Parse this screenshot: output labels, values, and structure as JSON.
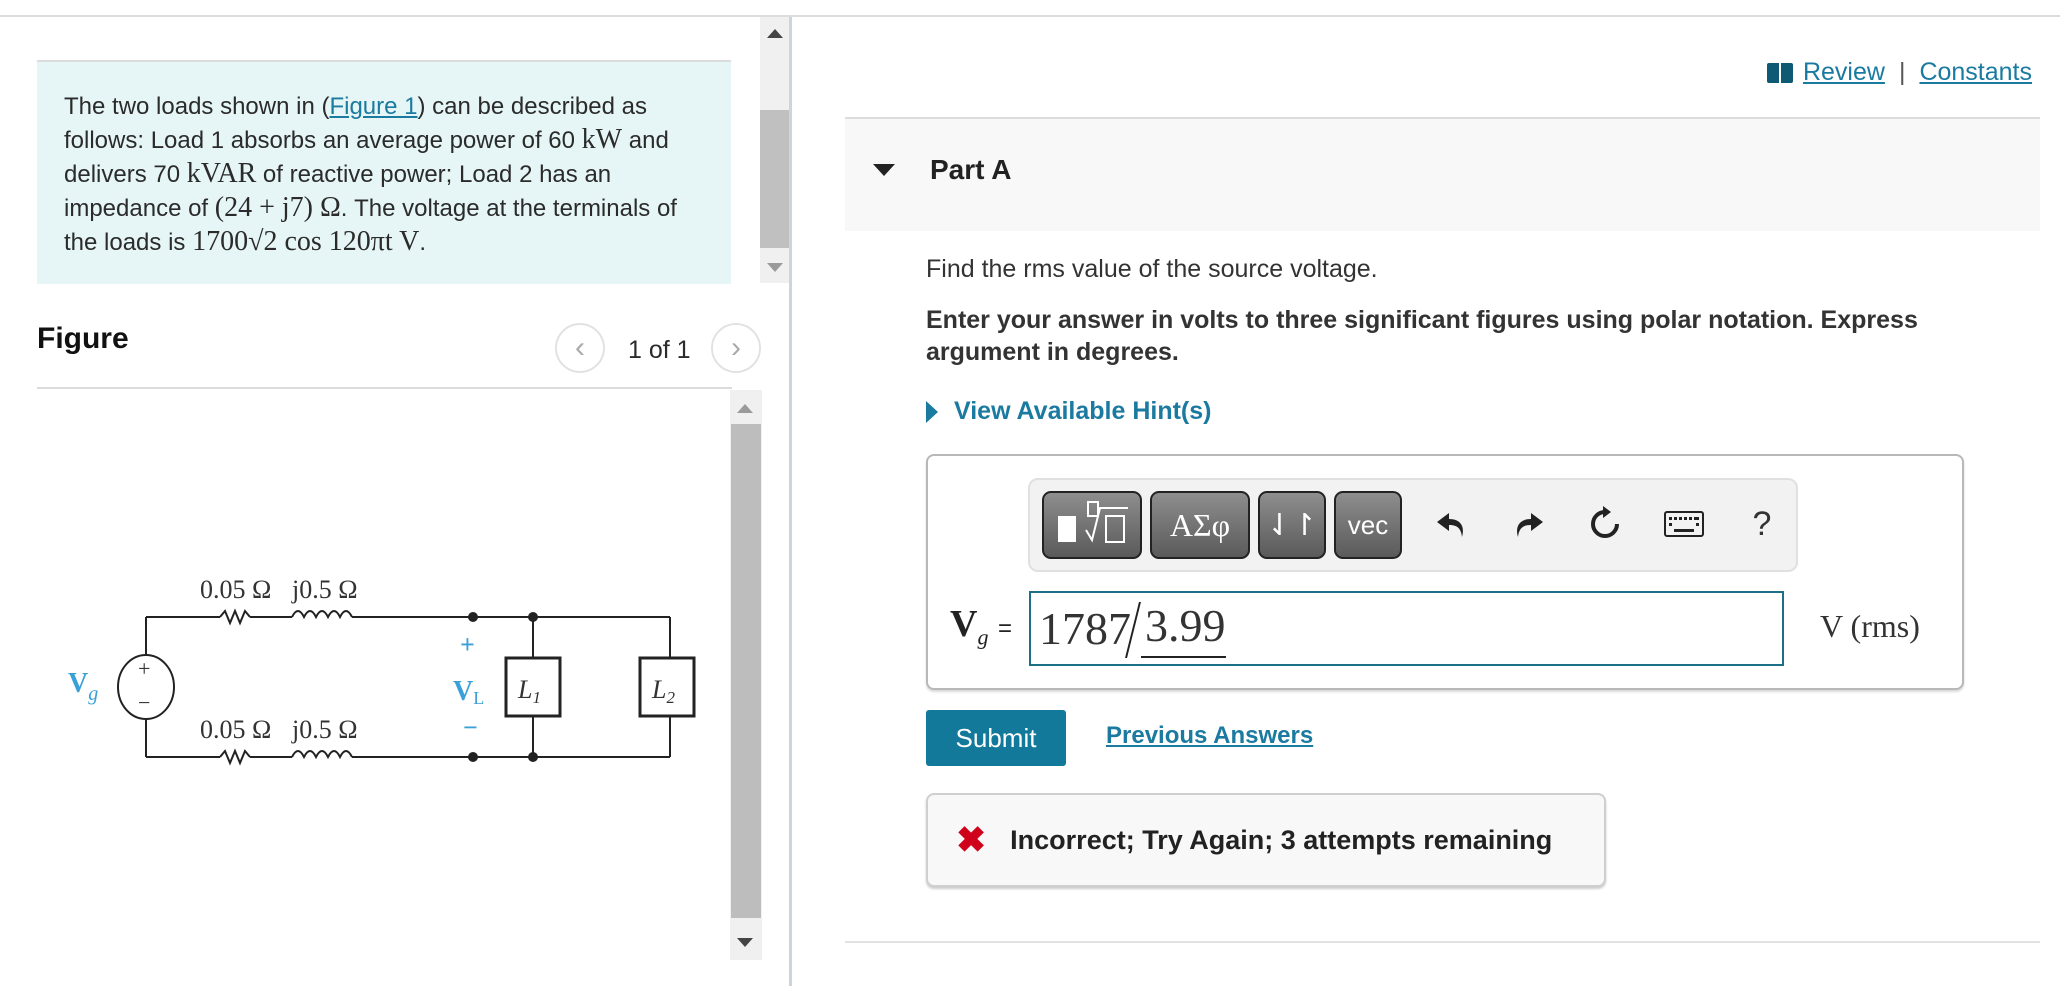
{
  "problem": {
    "text_parts": {
      "p1": "The two loads shown in (",
      "figure_link": "Figure 1",
      "p2": ") can be described as follows: Load 1 absorbs an average power of 60 ",
      "m_kw": "kW",
      "p3": " and delivers 70 ",
      "m_kvar": "kVAR",
      "p4": " of reactive power; Load 2 has an impedance of ",
      "m_imp": "(24 + j7)  Ω",
      "p5": ". The voltage at the terminals of the loads is ",
      "m_volt": "1700√2  cos 120πt  V",
      "p6": "."
    }
  },
  "figure": {
    "title": "Figure",
    "page_indicator": "1 of 1",
    "prev_icon": "chevron-left-icon",
    "next_icon": "chevron-right-icon",
    "circuit": {
      "top_resistor": "0.05 Ω",
      "top_inductor": "j0.5 Ω",
      "bottom_resistor": "0.05 Ω",
      "bottom_inductor": "j0.5 Ω",
      "source_label": "V",
      "source_sub": "g",
      "load_voltage_label": "V",
      "load_voltage_sub": "L",
      "plus": "+",
      "minus": "−",
      "load1": "L",
      "load1_sub": "1",
      "load2": "L",
      "load2_sub": "2",
      "wire_color": "#222222",
      "label_color": "#3aa0d8"
    }
  },
  "header_links": {
    "review": "Review",
    "separator": "|",
    "constants": "Constants"
  },
  "part": {
    "title": "Part A",
    "question": "Find the rms value of the source voltage.",
    "instruction": "Enter your answer in volts to three significant figures using polar notation. Express argument in degrees.",
    "hint_link": "View Available Hint(s)"
  },
  "toolbar": {
    "templates_icon": "templates-sqrt-icon",
    "greek_label": "ΑΣφ",
    "sort_label": "⇃↾",
    "vec_label": "vec",
    "help_label": "?"
  },
  "answer": {
    "variable": "V",
    "variable_sub": "g",
    "equals": "=",
    "magnitude": "1787",
    "angle": "3.99",
    "units": "V  (rms)"
  },
  "actions": {
    "submit": "Submit",
    "previous_answers": "Previous Answers"
  },
  "feedback": {
    "icon": "✖",
    "message": "Incorrect; Try Again; 3 attempts remaining",
    "status_color": "#d0021b"
  },
  "colors": {
    "accent": "#13799a",
    "link": "#1a7aa0",
    "problem_bg": "#e6f6f6"
  }
}
